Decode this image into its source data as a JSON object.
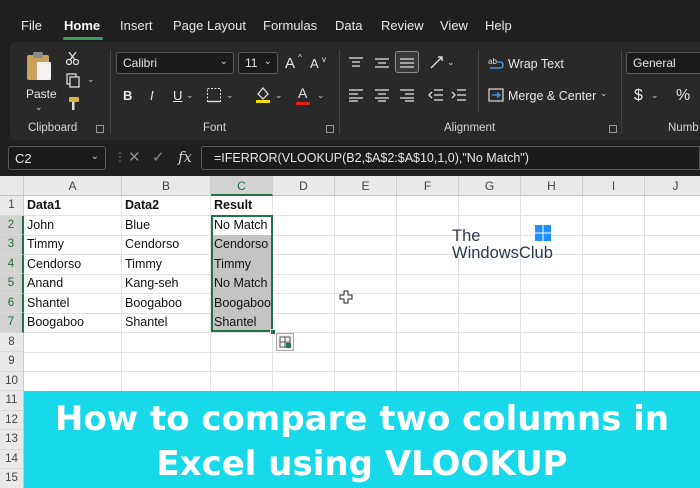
{
  "menu": {
    "tabs": [
      "File",
      "Home",
      "Insert",
      "Page Layout",
      "Formulas",
      "Data",
      "Review",
      "View",
      "Help"
    ],
    "active": "Home"
  },
  "ribbon": {
    "clipboard": {
      "paste_label": "Paste",
      "group_label": "Clipboard"
    },
    "font": {
      "font_name": "Calibri",
      "font_size": "11",
      "group_label": "Font",
      "bold": "B",
      "italic": "I",
      "underline": "U",
      "grow": "A",
      "shrink": "A"
    },
    "alignment": {
      "wrap_text": "Wrap Text",
      "merge_center": "Merge & Center",
      "group_label": "Alignment"
    },
    "number": {
      "format": "General",
      "group_label": "Numb",
      "currency": "$",
      "percent": "%"
    }
  },
  "formula_bar": {
    "name_box": "C2",
    "fx": "fx",
    "formula": "=IFERROR(VLOOKUP(B2,$A$2:$A$10,1,0),\"No Match\")"
  },
  "sheet": {
    "columns": [
      "A",
      "B",
      "C",
      "D",
      "E",
      "F",
      "G",
      "H",
      "I",
      "J"
    ],
    "selected_column": "C",
    "rows": [
      "1",
      "2",
      "3",
      "4",
      "5",
      "6",
      "7",
      "8",
      "9",
      "10",
      "11",
      "12",
      "13",
      "14",
      "15"
    ],
    "headers": [
      "Data1",
      "Data2",
      "Result"
    ],
    "data": [
      [
        "John",
        "Blue",
        "No Match"
      ],
      [
        "Timmy",
        "Cendorso",
        "Cendorso"
      ],
      [
        "Cendorso",
        "Timmy",
        "Timmy"
      ],
      [
        "Anand",
        "Kang-seh",
        "No Match"
      ],
      [
        "Shantel",
        "Boogaboo",
        "Boogaboo"
      ],
      [
        "Boogaboo",
        "Shantel",
        "Shantel"
      ]
    ]
  },
  "watermark": {
    "line1": "The",
    "line2": "WindowsClub"
  },
  "banner": {
    "line1": "How to compare two columns in",
    "line2": "Excel using VLOOKUP"
  },
  "colors": {
    "accent": "#217346",
    "banner": "#17d9e9",
    "ribbon": "#292929"
  }
}
